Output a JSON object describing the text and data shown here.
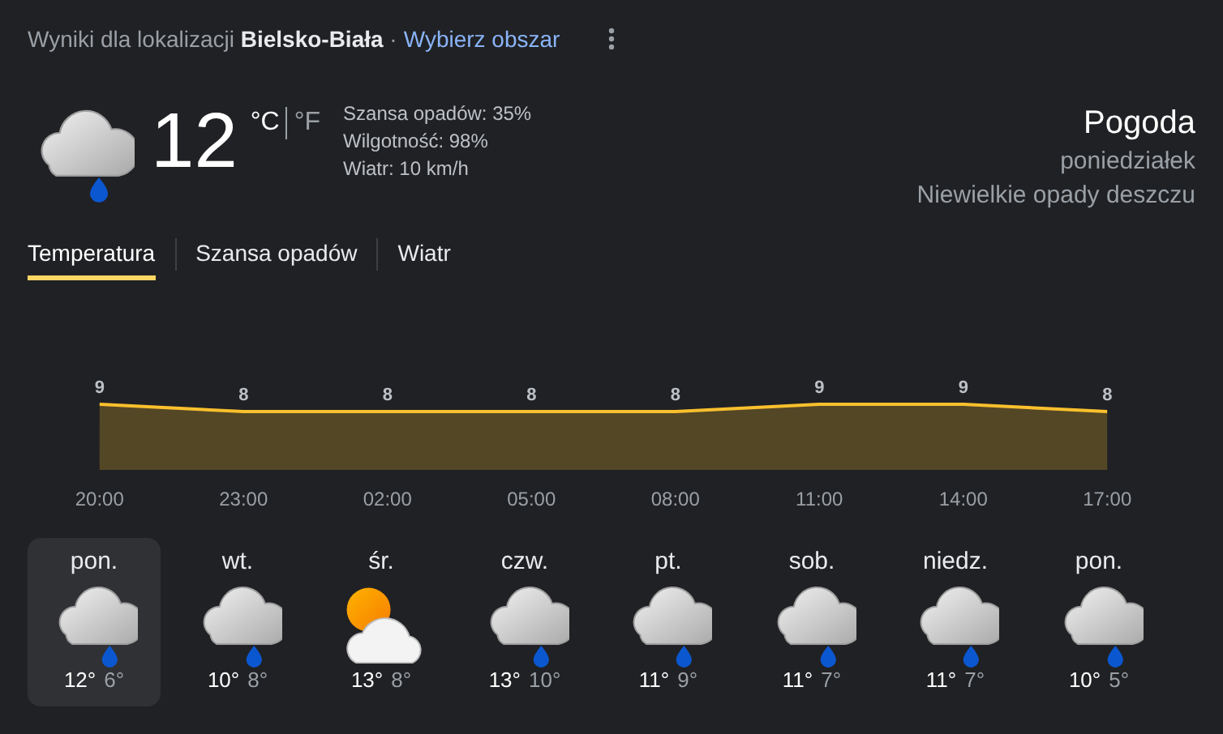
{
  "header": {
    "text": "Wyniki dla lokalizacji **Bielsko-Biała** ·",
    "link": "Wybierz obszar"
  },
  "current": {
    "kind": "rain",
    "temperature": "12",
    "units": [
      {
        "label": "°C",
        "selected": true
      },
      {
        "label": "°F",
        "selected": false
      }
    ],
    "details": [
      "Szansa opadów: 35%",
      "Wilgotność: 98%",
      "Wiatr: 10 km/h"
    ]
  },
  "summary": {
    "title": "Pogoda",
    "day": "poniedziałek",
    "description": "Niewielkie opady deszczu"
  },
  "tabs": [
    {
      "label": "Temperatura",
      "selected": true
    },
    {
      "label": "Szansa opadów",
      "selected": false
    },
    {
      "label": "Wiatr",
      "selected": false
    }
  ],
  "chart_data": {
    "type": "area",
    "categories": [
      "20:00",
      "23:00",
      "02:00",
      "05:00",
      "08:00",
      "11:00",
      "14:00",
      "17:00"
    ],
    "series": [
      {
        "color": "#fbc02d",
        "values": [
          9,
          8,
          8,
          8,
          8,
          9,
          9,
          8
        ]
      }
    ],
    "data_labels": true
  },
  "days": [
    {
      "name": "pon.",
      "kind": "rain",
      "high": "12°",
      "low": "6°",
      "selected": true
    },
    {
      "name": "wt.",
      "kind": "rain",
      "high": "10°",
      "low": "8°",
      "selected": false
    },
    {
      "name": "śr.",
      "kind": "partly_cloudy",
      "high": "13°",
      "low": "8°",
      "selected": false
    },
    {
      "name": "czw.",
      "kind": "rain",
      "high": "13°",
      "low": "10°",
      "selected": false
    },
    {
      "name": "pt.",
      "kind": "rain",
      "high": "11°",
      "low": "9°",
      "selected": false
    },
    {
      "name": "sob.",
      "kind": "rain",
      "high": "11°",
      "low": "7°",
      "selected": false
    },
    {
      "name": "niedz.",
      "kind": "rain",
      "high": "11°",
      "low": "7°",
      "selected": false
    },
    {
      "name": "pon.",
      "kind": "rain",
      "high": "10°",
      "low": "5°",
      "selected": false
    }
  ]
}
